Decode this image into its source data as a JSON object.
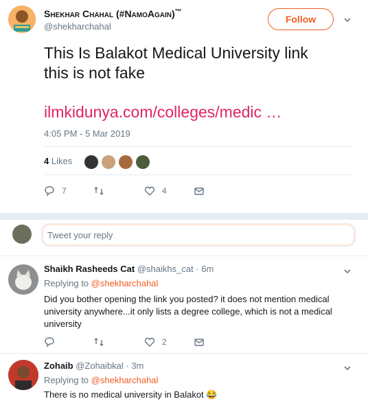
{
  "tweet": {
    "author_name": "Shekhar Chahal (#NamoAgain)",
    "tm": "™",
    "handle": "@shekharchahal",
    "follow_label": "Follow",
    "text_line1": "This Is Balakot Medical University link",
    "text_line2": "this is not fake",
    "link": "ilmkidunya.com/colleges/medic …",
    "timestamp": "4:05 PM - 5 Mar 2019",
    "likes_count": "4",
    "likes_label": "Likes",
    "actions": {
      "replies": "7",
      "retweets": "",
      "likes": "4"
    }
  },
  "reply_box": {
    "placeholder": "Tweet your reply"
  },
  "replies": [
    {
      "name": "Shaikh Rasheeds Cat",
      "handle": "@shaikhs_cat",
      "time": "· 6m",
      "replying_label": "Replying to",
      "replying_handle": "@shekharchahal",
      "text": "Did you bother opening the link you posted? it does not mention medical university anywhere...it only lists a degree college, which is not a medical university",
      "likes": "2"
    },
    {
      "name": "Zohaib",
      "handle": "@Zohaibkal",
      "time": "· 3m",
      "replying_label": "Replying to",
      "replying_handle": "@shekharchahal",
      "text": "There is no medical university in Balakot 😂"
    }
  ],
  "colors": {
    "accent": "#f45d22",
    "link": "#e0245e",
    "muted": "#657786"
  }
}
